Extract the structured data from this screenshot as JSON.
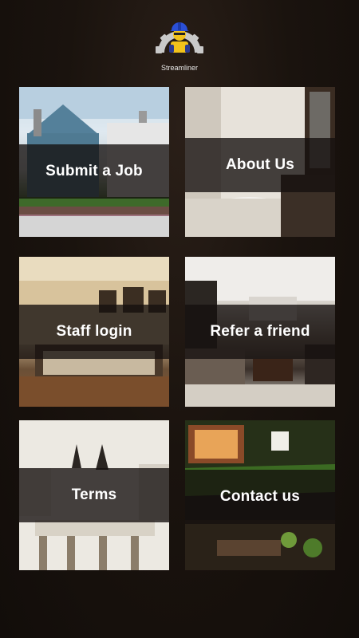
{
  "app": {
    "logo_text": "Streamliner",
    "logo_icon": "worker-gear-icon"
  },
  "tiles": [
    {
      "label": "Submit a Job",
      "image": "house-exterior-photo"
    },
    {
      "label": "About Us",
      "image": "bathroom-photo"
    },
    {
      "label": "Staff login",
      "image": "bedroom-photo"
    },
    {
      "label": "Refer a friend",
      "image": "living-room-photo"
    },
    {
      "label": "Terms",
      "image": "kitchen-photo"
    },
    {
      "label": "Contact us",
      "image": "garden-photo"
    }
  ]
}
